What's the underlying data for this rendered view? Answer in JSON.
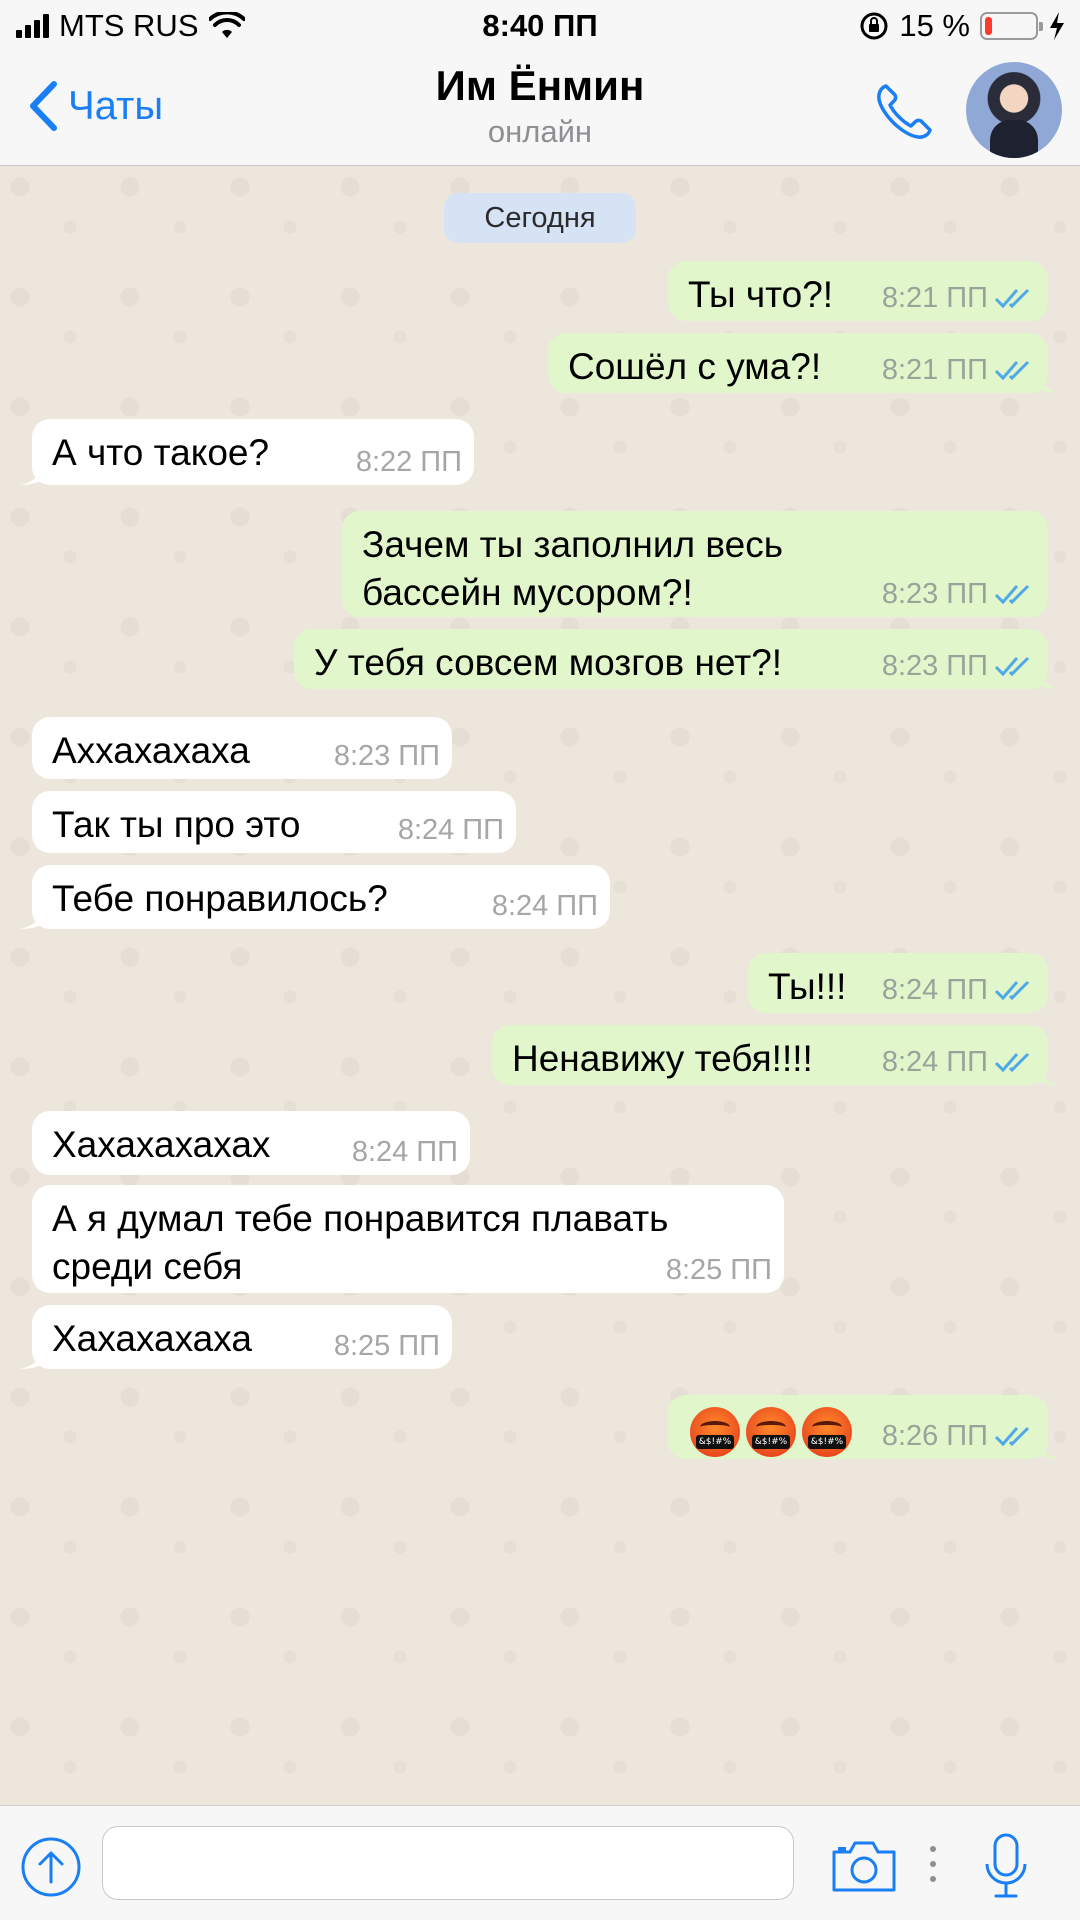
{
  "status_bar": {
    "carrier": "MTS RUS",
    "time": "8:40 ПП",
    "battery_percent": "15 %",
    "battery_level": 0.15
  },
  "header": {
    "back_label": "Чаты",
    "contact_name": "Им Ёнмин",
    "contact_status": "онлайн"
  },
  "chat": {
    "date_divider": "Сегодня",
    "messages": [
      {
        "dir": "out",
        "text": "Ты что?!",
        "time": "8:21 ПП"
      },
      {
        "dir": "out",
        "text": "Сошёл с ума?!",
        "time": "8:21 ПП"
      },
      {
        "dir": "in",
        "text": "А что такое?",
        "time": "8:22 ПП"
      },
      {
        "dir": "out",
        "text": "Зачем ты заполнил весь\nбассейн мусором?!",
        "time": "8:23 ПП"
      },
      {
        "dir": "out",
        "text": "У тебя совсем мозгов нет?!",
        "time": "8:23 ПП"
      },
      {
        "dir": "in",
        "text": "Аххахахаха",
        "time": "8:23 ПП"
      },
      {
        "dir": "in",
        "text": "Так ты про это",
        "time": "8:24 ПП"
      },
      {
        "dir": "in",
        "text": "Тебе понравилось?",
        "time": "8:24 ПП"
      },
      {
        "dir": "out",
        "text": "Ты!!!",
        "time": "8:24 ПП"
      },
      {
        "dir": "out",
        "text": "Ненавижу тебя!!!!",
        "time": "8:24 ПП"
      },
      {
        "dir": "in",
        "text": "Хахахахахах",
        "time": "8:24 ПП"
      },
      {
        "dir": "in",
        "text": "А я думал тебе понравится плавать\nсреди себя",
        "time": "8:25 ПП"
      },
      {
        "dir": "in",
        "text": "Хахахахаха",
        "time": "8:25 ПП"
      },
      {
        "dir": "out",
        "emoji": [
          "face-with-symbols-on-mouth",
          "face-with-symbols-on-mouth",
          "face-with-symbols-on-mouth"
        ],
        "emoji_glyph": "&$!#%",
        "time": "8:26 ПП"
      }
    ]
  },
  "icons": {
    "back": "chevron-left-icon",
    "call": "phone-icon",
    "attach": "upload-arrow-icon",
    "camera": "camera-icon",
    "mic": "microphone-icon",
    "read_receipt": "double-check-icon"
  },
  "colors": {
    "accent": "#1a7ff5",
    "outgoing_bubble": "#e1f7cb",
    "incoming_bubble": "#ffffff",
    "read_ticks": "#4fa9e8",
    "date_badge": "#d5e3f5",
    "battery_low": "#ff3b30"
  }
}
